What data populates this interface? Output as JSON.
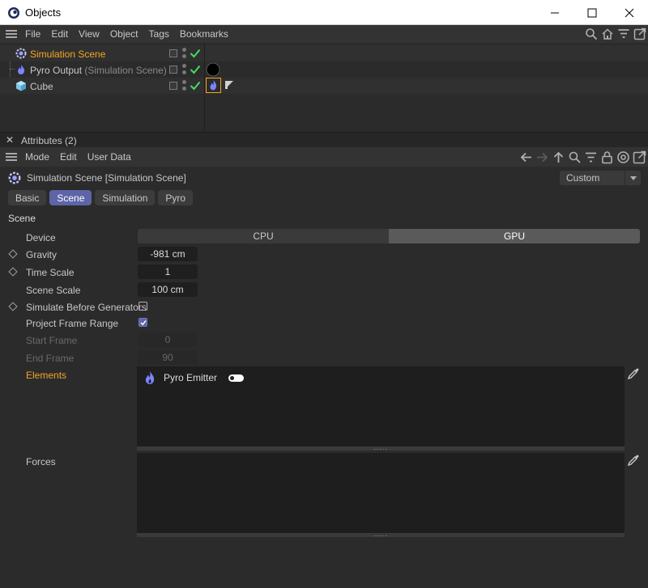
{
  "window": {
    "title": "Objects",
    "minimize_icon": "minimize-icon",
    "maximize_icon": "maximize-icon",
    "close_icon": "close-icon"
  },
  "object_manager": {
    "menu": [
      "File",
      "Edit",
      "View",
      "Object",
      "Tags",
      "Bookmarks"
    ],
    "tool_icons": [
      "search-icon",
      "home-icon",
      "filter-icon",
      "new-window-icon"
    ],
    "objects": [
      {
        "name": "Simulation Scene",
        "suffix": "",
        "icon": "simulation-scene-icon",
        "selected": true
      },
      {
        "name": "Pyro Output",
        "suffix": "(Simulation Scene)",
        "icon": "pyro-flame-icon",
        "selected": false
      },
      {
        "name": "Cube",
        "suffix": "",
        "icon": "cube-icon",
        "selected": false
      }
    ]
  },
  "attributes": {
    "panel_title": "Attributes (2)",
    "menu": [
      "Mode",
      "Edit",
      "User Data"
    ],
    "tool_icons": [
      "back-arrow-icon",
      "forward-arrow-icon",
      "up-arrow-icon",
      "search-icon",
      "filter-icon",
      "lock-icon",
      "target-icon",
      "new-window-icon"
    ],
    "object_title": "Simulation Scene [Simulation Scene]",
    "preset": "Custom",
    "tabs": [
      {
        "label": "Basic",
        "active": false
      },
      {
        "label": "Scene",
        "active": true
      },
      {
        "label": "Simulation",
        "active": false
      },
      {
        "label": "Pyro",
        "active": false
      }
    ],
    "section_title": "Scene",
    "device": {
      "label": "Device",
      "options": [
        "CPU",
        "GPU"
      ],
      "selected": "GPU"
    },
    "gravity": {
      "label": "Gravity",
      "value": "-981 cm"
    },
    "time_scale": {
      "label": "Time Scale",
      "value": "1"
    },
    "scene_scale": {
      "label": "Scene Scale",
      "value": "100 cm"
    },
    "simulate_before_generators": {
      "label": "Simulate Before Generators",
      "checked": false
    },
    "project_frame_range": {
      "label": "Project Frame Range",
      "checked": true
    },
    "start_frame": {
      "label": "Start Frame",
      "value": "0"
    },
    "end_frame": {
      "label": "End Frame",
      "value": "90"
    },
    "elements": {
      "label": "Elements",
      "items": [
        {
          "name": "Pyro Emitter",
          "enabled": true
        }
      ]
    },
    "forces": {
      "label": "Forces",
      "items": []
    },
    "grip_text": "....."
  },
  "colors": {
    "accent": "#5d65a8",
    "selected_text": "#f5a623",
    "check_green": "#4cd964",
    "pyro_flame": "#7c84ff"
  }
}
